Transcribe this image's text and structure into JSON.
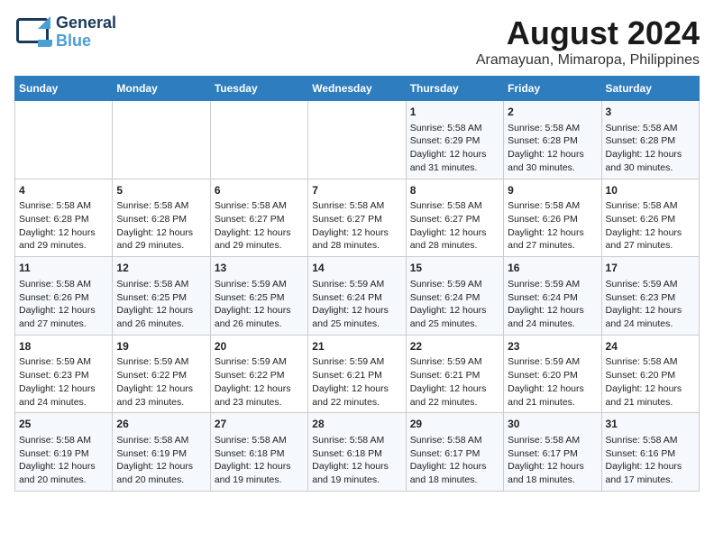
{
  "logo": {
    "line1": "General",
    "line2": "Blue"
  },
  "title": "August 2024",
  "subtitle": "Aramayuan, Mimaropa, Philippines",
  "days_of_week": [
    "Sunday",
    "Monday",
    "Tuesday",
    "Wednesday",
    "Thursday",
    "Friday",
    "Saturday"
  ],
  "weeks": [
    [
      {
        "day": "",
        "info": ""
      },
      {
        "day": "",
        "info": ""
      },
      {
        "day": "",
        "info": ""
      },
      {
        "day": "",
        "info": ""
      },
      {
        "day": "1",
        "info": "Sunrise: 5:58 AM\nSunset: 6:29 PM\nDaylight: 12 hours and 31 minutes."
      },
      {
        "day": "2",
        "info": "Sunrise: 5:58 AM\nSunset: 6:28 PM\nDaylight: 12 hours and 30 minutes."
      },
      {
        "day": "3",
        "info": "Sunrise: 5:58 AM\nSunset: 6:28 PM\nDaylight: 12 hours and 30 minutes."
      }
    ],
    [
      {
        "day": "4",
        "info": "Sunrise: 5:58 AM\nSunset: 6:28 PM\nDaylight: 12 hours and 29 minutes."
      },
      {
        "day": "5",
        "info": "Sunrise: 5:58 AM\nSunset: 6:28 PM\nDaylight: 12 hours and 29 minutes."
      },
      {
        "day": "6",
        "info": "Sunrise: 5:58 AM\nSunset: 6:27 PM\nDaylight: 12 hours and 29 minutes."
      },
      {
        "day": "7",
        "info": "Sunrise: 5:58 AM\nSunset: 6:27 PM\nDaylight: 12 hours and 28 minutes."
      },
      {
        "day": "8",
        "info": "Sunrise: 5:58 AM\nSunset: 6:27 PM\nDaylight: 12 hours and 28 minutes."
      },
      {
        "day": "9",
        "info": "Sunrise: 5:58 AM\nSunset: 6:26 PM\nDaylight: 12 hours and 27 minutes."
      },
      {
        "day": "10",
        "info": "Sunrise: 5:58 AM\nSunset: 6:26 PM\nDaylight: 12 hours and 27 minutes."
      }
    ],
    [
      {
        "day": "11",
        "info": "Sunrise: 5:58 AM\nSunset: 6:26 PM\nDaylight: 12 hours and 27 minutes."
      },
      {
        "day": "12",
        "info": "Sunrise: 5:58 AM\nSunset: 6:25 PM\nDaylight: 12 hours and 26 minutes."
      },
      {
        "day": "13",
        "info": "Sunrise: 5:59 AM\nSunset: 6:25 PM\nDaylight: 12 hours and 26 minutes."
      },
      {
        "day": "14",
        "info": "Sunrise: 5:59 AM\nSunset: 6:24 PM\nDaylight: 12 hours and 25 minutes."
      },
      {
        "day": "15",
        "info": "Sunrise: 5:59 AM\nSunset: 6:24 PM\nDaylight: 12 hours and 25 minutes."
      },
      {
        "day": "16",
        "info": "Sunrise: 5:59 AM\nSunset: 6:24 PM\nDaylight: 12 hours and 24 minutes."
      },
      {
        "day": "17",
        "info": "Sunrise: 5:59 AM\nSunset: 6:23 PM\nDaylight: 12 hours and 24 minutes."
      }
    ],
    [
      {
        "day": "18",
        "info": "Sunrise: 5:59 AM\nSunset: 6:23 PM\nDaylight: 12 hours and 24 minutes."
      },
      {
        "day": "19",
        "info": "Sunrise: 5:59 AM\nSunset: 6:22 PM\nDaylight: 12 hours and 23 minutes."
      },
      {
        "day": "20",
        "info": "Sunrise: 5:59 AM\nSunset: 6:22 PM\nDaylight: 12 hours and 23 minutes."
      },
      {
        "day": "21",
        "info": "Sunrise: 5:59 AM\nSunset: 6:21 PM\nDaylight: 12 hours and 22 minutes."
      },
      {
        "day": "22",
        "info": "Sunrise: 5:59 AM\nSunset: 6:21 PM\nDaylight: 12 hours and 22 minutes."
      },
      {
        "day": "23",
        "info": "Sunrise: 5:59 AM\nSunset: 6:20 PM\nDaylight: 12 hours and 21 minutes."
      },
      {
        "day": "24",
        "info": "Sunrise: 5:58 AM\nSunset: 6:20 PM\nDaylight: 12 hours and 21 minutes."
      }
    ],
    [
      {
        "day": "25",
        "info": "Sunrise: 5:58 AM\nSunset: 6:19 PM\nDaylight: 12 hours and 20 minutes."
      },
      {
        "day": "26",
        "info": "Sunrise: 5:58 AM\nSunset: 6:19 PM\nDaylight: 12 hours and 20 minutes."
      },
      {
        "day": "27",
        "info": "Sunrise: 5:58 AM\nSunset: 6:18 PM\nDaylight: 12 hours and 19 minutes."
      },
      {
        "day": "28",
        "info": "Sunrise: 5:58 AM\nSunset: 6:18 PM\nDaylight: 12 hours and 19 minutes."
      },
      {
        "day": "29",
        "info": "Sunrise: 5:58 AM\nSunset: 6:17 PM\nDaylight: 12 hours and 18 minutes."
      },
      {
        "day": "30",
        "info": "Sunrise: 5:58 AM\nSunset: 6:17 PM\nDaylight: 12 hours and 18 minutes."
      },
      {
        "day": "31",
        "info": "Sunrise: 5:58 AM\nSunset: 6:16 PM\nDaylight: 12 hours and 17 minutes."
      }
    ]
  ]
}
